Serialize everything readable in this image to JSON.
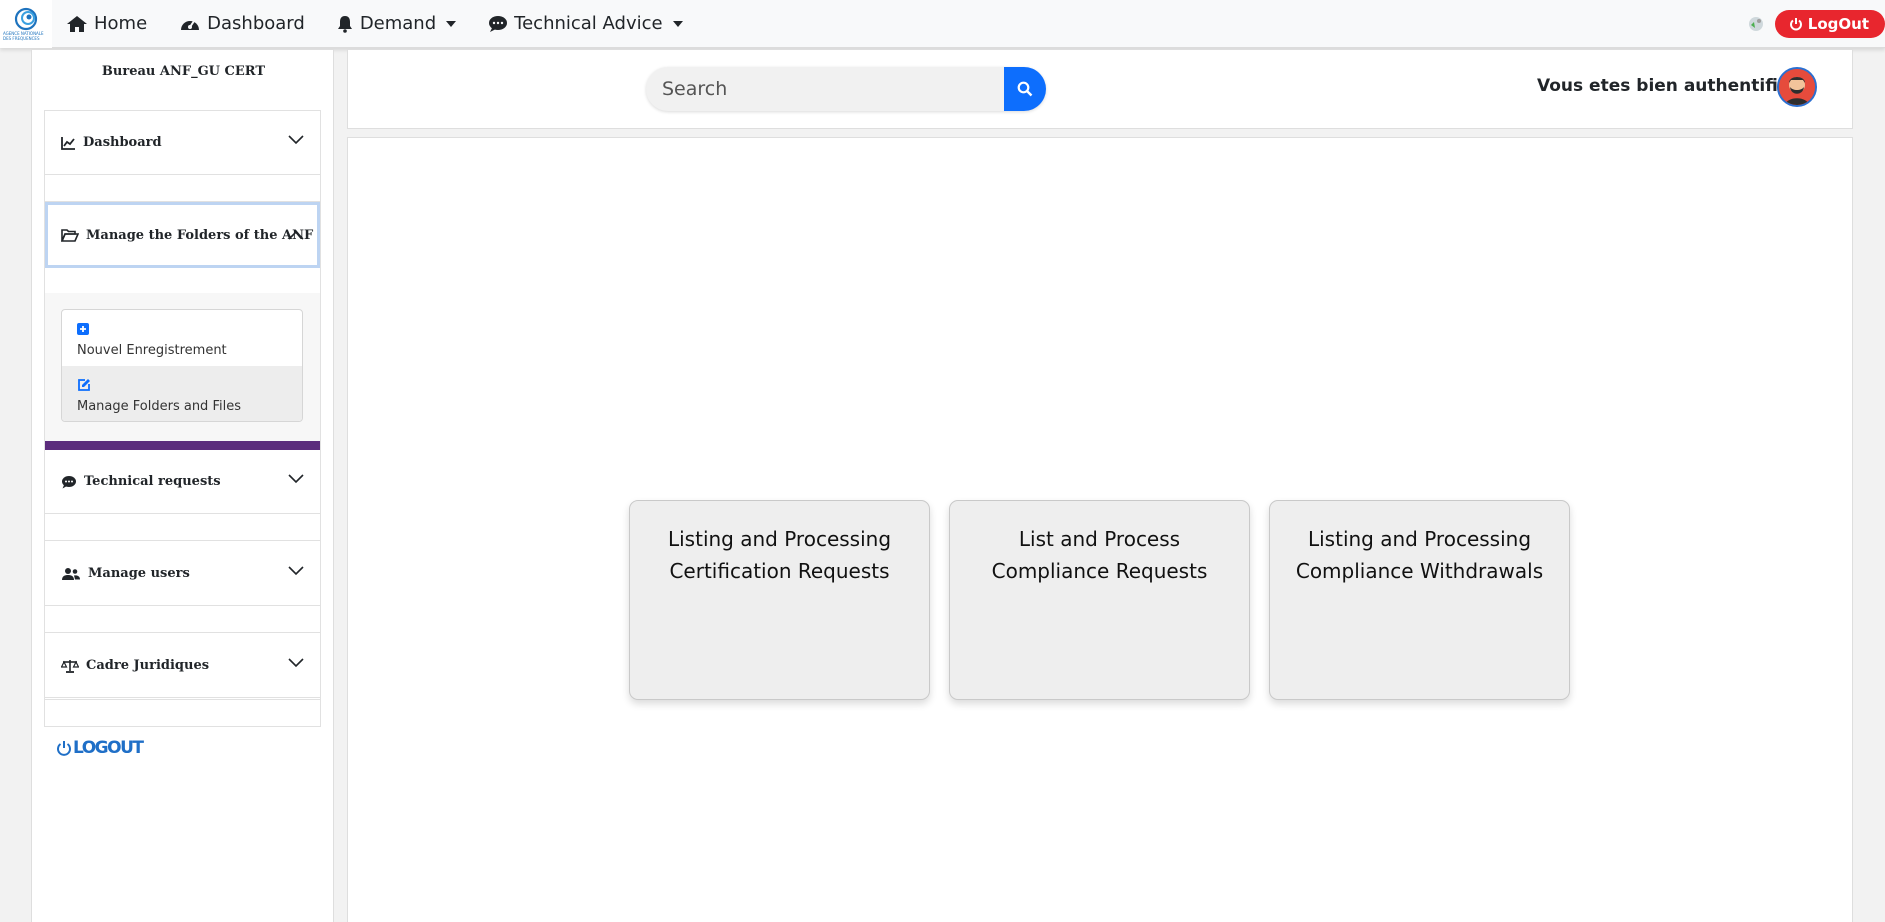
{
  "navbar": {
    "brand_text": "AGENCE NATIONALE DES FREQUENCES",
    "items": [
      {
        "label": "Home",
        "icon": "home-icon"
      },
      {
        "label": "Dashboard",
        "icon": "tachometer-icon"
      },
      {
        "label": "Demand",
        "icon": "bell-icon",
        "dropdown": true
      },
      {
        "label": "Technical Advice",
        "icon": "comment-icon",
        "dropdown": true
      }
    ],
    "logout_label": "LogOut",
    "logout_color": "#e8262e"
  },
  "sidebar": {
    "bureau": "Bureau ANF_GU CERT",
    "sections": [
      {
        "label": "Dashboard",
        "icon": "chart-line-icon",
        "expanded": false
      },
      {
        "label": "Manage the Folders of the ANF",
        "icon": "folder-open-icon",
        "expanded": true
      },
      {
        "label": "Technical requests",
        "icon": "comment-icon",
        "expanded": false
      },
      {
        "label": "Manage users",
        "icon": "users-icon",
        "expanded": false
      },
      {
        "label": "Cadre Juridiques",
        "icon": "balance-scale-icon",
        "expanded": false
      }
    ],
    "subitems": [
      {
        "label": "Nouvel Enregistrement",
        "icon": "plus-square-icon"
      },
      {
        "label": "Manage Folders and Files",
        "icon": "edit-icon"
      }
    ],
    "logout_label": "LOGOUT",
    "accent_color": "#5b2c7c"
  },
  "header": {
    "search_placeholder": "Search",
    "auth_text": "Vous etes bien authentifié"
  },
  "tiles": [
    {
      "label": "Listing and Processing Certification Requests"
    },
    {
      "label": "List and Process Compliance Requests"
    },
    {
      "label": "Listing and Processing Compliance Withdrawals"
    }
  ]
}
